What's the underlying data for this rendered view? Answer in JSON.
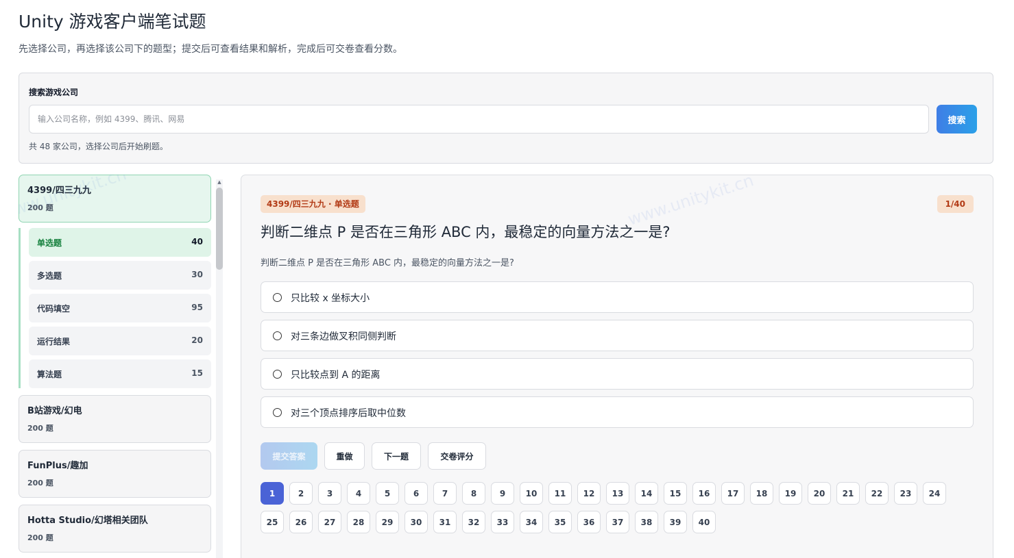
{
  "page": {
    "title": "Unity 游戏客户端笔试题",
    "subtitle": "先选择公司，再选择该公司下的题型；提交后可查看结果和解析，完成后可交卷查看分数。"
  },
  "search": {
    "label": "搜索游戏公司",
    "placeholder": "输入公司名称，例如 4399、腾讯、网易",
    "button_label": "搜索",
    "hint": "共 48 家公司，选择公司后开始刷题。"
  },
  "companies": [
    {
      "name": "4399/四三九九",
      "count": "200 题",
      "active": true
    },
    {
      "name": "B站游戏/幻电",
      "count": "200 题",
      "active": false
    },
    {
      "name": "FunPlus/趣加",
      "count": "200 题",
      "active": false
    },
    {
      "name": "Hotta Studio/幻塔相关团队",
      "count": "200 题",
      "active": false
    }
  ],
  "question_types": [
    {
      "name": "单选题",
      "count": "40",
      "active": true
    },
    {
      "name": "多选题",
      "count": "30",
      "active": false
    },
    {
      "name": "代码填空",
      "count": "95",
      "active": false
    },
    {
      "name": "运行结果",
      "count": "20",
      "active": false
    },
    {
      "name": "算法题",
      "count": "15",
      "active": false
    }
  ],
  "question": {
    "tag": "4399/四三九九 · 单选题",
    "progress": "1/40",
    "title": "判断二维点 P 是否在三角形 ABC 内，最稳定的向量方法之一是?",
    "description": "判断二维点 P 是否在三角形 ABC 内，最稳定的向量方法之一是?",
    "options": [
      "只比较 x 坐标大小",
      "对三条边做叉积同侧判断",
      "只比较点到 A 的距离",
      "对三个顶点排序后取中位数"
    ]
  },
  "actions": {
    "submit": "提交答案",
    "reset": "重做",
    "next": "下一题",
    "finish": "交卷评分"
  },
  "question_numbers": [
    "1",
    "2",
    "3",
    "4",
    "5",
    "6",
    "7",
    "8",
    "9",
    "10",
    "11",
    "12",
    "13",
    "14",
    "15",
    "16",
    "17",
    "18",
    "19",
    "20",
    "21",
    "22",
    "23",
    "24",
    "25",
    "26",
    "27",
    "28",
    "29",
    "30",
    "31",
    "32",
    "33",
    "34",
    "35",
    "36",
    "37",
    "38",
    "39",
    "40"
  ],
  "current_question": 1,
  "watermark": "www.unitykit.cn",
  "colors": {
    "accent": "#4a63d6",
    "search_button": "#3f7ee6",
    "active_company": "#e6f6ee",
    "tag_bg": "#f8e0cd",
    "tag_text": "#b23a15"
  }
}
